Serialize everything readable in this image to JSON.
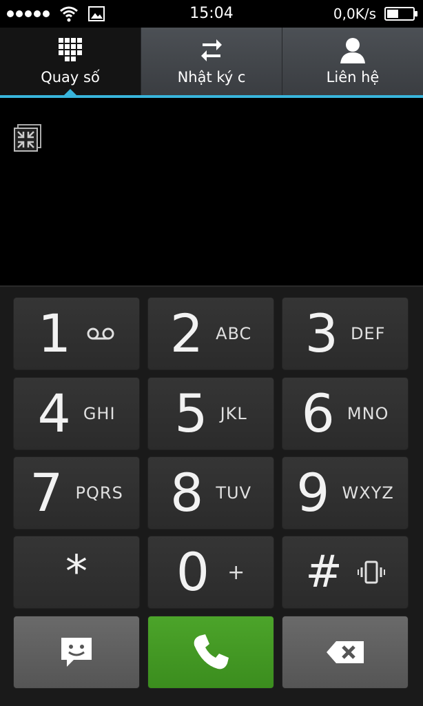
{
  "status_bar": {
    "time": "15:04",
    "network_speed": "0,0K/s",
    "icons": [
      "signal-dots-icon",
      "wifi-icon",
      "image-icon",
      "battery-icon"
    ]
  },
  "tabs": [
    {
      "label": "Quay số",
      "icon": "dialpad-icon",
      "active": true
    },
    {
      "label": "Nhật ký c",
      "icon": "call-log-arrows-icon",
      "active": false
    },
    {
      "label": "Liên hệ",
      "icon": "contact-person-icon",
      "active": false
    }
  ],
  "colors": {
    "accent": "#38b5dc",
    "call_green": "#43a024",
    "key_bg": "#303030",
    "keypad_bg": "#1a1a1a"
  },
  "keys": [
    {
      "digit": "1",
      "letters": "",
      "icon": "voicemail-icon"
    },
    {
      "digit": "2",
      "letters": "ABC"
    },
    {
      "digit": "3",
      "letters": "DEF"
    },
    {
      "digit": "4",
      "letters": "GHI"
    },
    {
      "digit": "5",
      "letters": "JKL"
    },
    {
      "digit": "6",
      "letters": "MNO"
    },
    {
      "digit": "7",
      "letters": "PQRS"
    },
    {
      "digit": "8",
      "letters": "TUV"
    },
    {
      "digit": "9",
      "letters": "WXYZ"
    },
    {
      "digit": "*",
      "letters": ""
    },
    {
      "digit": "0",
      "letters": "+"
    },
    {
      "digit": "#",
      "letters": "",
      "icon": "vibrate-icon"
    }
  ],
  "actions": {
    "message_icon": "message-smiley-icon",
    "call_icon": "phone-handset-icon",
    "backspace_icon": "backspace-icon"
  }
}
